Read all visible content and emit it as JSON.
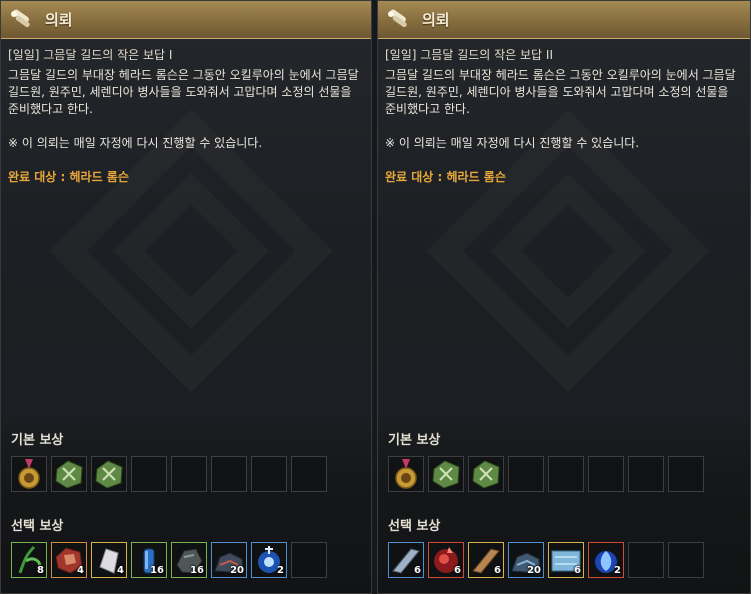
{
  "panels": [
    {
      "header_title": "의뢰",
      "quest_name": "[일일] 그믐달 길드의 작은 보답 I",
      "description": "그믐달 길드의 부대장 헤라드 롬슨은 그동안 오킬루아의 눈에서 그믐달 길드원, 원주민, 세렌디아 병사들을 도와줘서 고맙다며 소정의 선물을 준비했다고 한다.",
      "note": "※ 이 의뢰는 매일 자정에 다시 진행할 수 있습니다.",
      "target": "완료 대상 : 헤라드 롬슨",
      "basic_reward_label": "기본 보상",
      "choice_reward_label": "선택 보상",
      "basic_rewards": [
        {
          "icon": "medal-icon",
          "count": ""
        },
        {
          "icon": "green-ore-icon",
          "count": ""
        },
        {
          "icon": "green-ore-icon",
          "count": ""
        }
      ],
      "choice_rewards": [
        {
          "icon": "herb-icon",
          "count": "8",
          "grade": "green"
        },
        {
          "icon": "red-stone-icon",
          "count": "4",
          "grade": "orange"
        },
        {
          "icon": "silver-crystal-icon",
          "count": "4",
          "grade": "yellow"
        },
        {
          "icon": "blue-vial-icon",
          "count": "16",
          "grade": "green"
        },
        {
          "icon": "dark-stone-icon",
          "count": "16",
          "grade": "green"
        },
        {
          "icon": "ore-pile-icon",
          "count": "20",
          "grade": "blue"
        },
        {
          "icon": "blue-spirit-icon",
          "count": "2",
          "grade": "blue"
        }
      ]
    },
    {
      "header_title": "의뢰",
      "quest_name": "[일일] 그믐달 길드의 작은 보답 II",
      "description": "그믐달 길드의 부대장 헤라드 롬슨은 그동안 오킬루아의 눈에서 그믐달 길드원, 원주민, 세렌디아 병사들을 도와줘서 고맙다며 소정의 선물을 준비했다고 한다.",
      "note": "※ 이 의뢰는 매일 자정에 다시 진행할 수 있습니다.",
      "target": "완료 대상 : 헤라드 롬슨",
      "basic_reward_label": "기본 보상",
      "choice_reward_label": "선택 보상",
      "basic_rewards": [
        {
          "icon": "medal-icon",
          "count": ""
        },
        {
          "icon": "green-ore-icon",
          "count": ""
        },
        {
          "icon": "green-ore-icon",
          "count": ""
        }
      ],
      "choice_rewards": [
        {
          "icon": "steel-ingot-icon",
          "count": "6",
          "grade": "blue"
        },
        {
          "icon": "red-essence-icon",
          "count": "6",
          "grade": "red"
        },
        {
          "icon": "bronze-ingot-icon",
          "count": "6",
          "grade": "yellow"
        },
        {
          "icon": "ore-pile-icon",
          "count": "20",
          "grade": "blue"
        },
        {
          "icon": "ice-plate-icon",
          "count": "6",
          "grade": "yellow"
        },
        {
          "icon": "blue-spirit-icon",
          "count": "2",
          "grade": "red"
        }
      ]
    }
  ]
}
